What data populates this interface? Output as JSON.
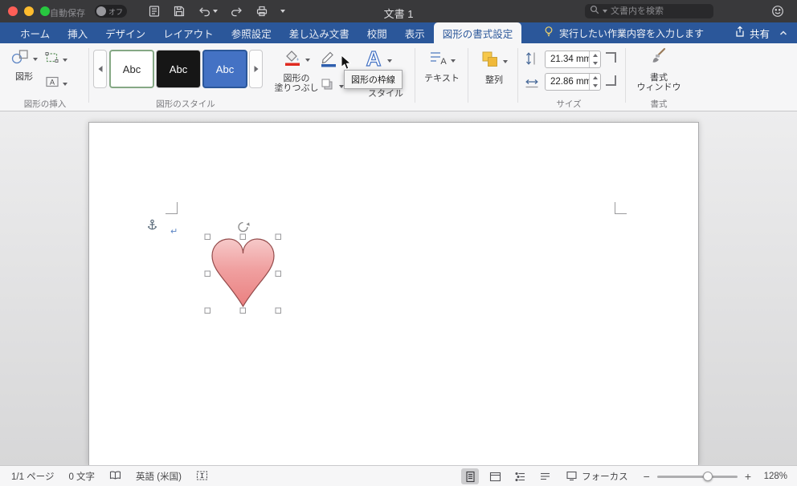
{
  "titlebar": {
    "autosave_label": "自動保存",
    "autosave_state": "オフ",
    "document_title": "文書 1",
    "search_placeholder": "文書内を検索"
  },
  "tabbar": {
    "tabs": [
      {
        "label": "ホーム"
      },
      {
        "label": "挿入"
      },
      {
        "label": "デザイン"
      },
      {
        "label": "レイアウト"
      },
      {
        "label": "参照設定"
      },
      {
        "label": "差し込み文書"
      },
      {
        "label": "校閲"
      },
      {
        "label": "表示"
      },
      {
        "label": "図形の書式設定"
      }
    ],
    "active_tab": "図形の書式設定",
    "tell_me": "実行したい作業内容を入力します",
    "share_label": "共有"
  },
  "ribbon": {
    "insert_shapes_group": {
      "label": "図形の挿入",
      "shapes_button": "図形"
    },
    "shape_styles_group": {
      "label": "図形のスタイル",
      "style_samples": [
        "Abc",
        "Abc",
        "Abc"
      ],
      "fill_button_line1": "図形の",
      "fill_button_line2": "塗りつぶし",
      "partial_styles_label": "スタイル"
    },
    "text_button": "テキスト",
    "arrange_button": "整列",
    "size_group": {
      "label": "サイズ",
      "height_value": "21.34 mm",
      "width_value": "22.86 mm"
    },
    "format_pane_group": {
      "label": "書式",
      "button_line1": "書式",
      "button_line2": "ウィンドウ"
    }
  },
  "tooltip": {
    "text": "図形の枠線"
  },
  "statusbar": {
    "page_indicator": "1/1 ページ",
    "word_count": "0 文字",
    "language": "英語 (米国)",
    "focus_label": "フォーカス",
    "zoom_level": "128%"
  },
  "colors": {
    "accent_blue": "#2b579a",
    "style_sample_blue": "#4472c4",
    "fill_bar_red": "#e02b20",
    "outline_bar_blue": "#2f5fae"
  }
}
